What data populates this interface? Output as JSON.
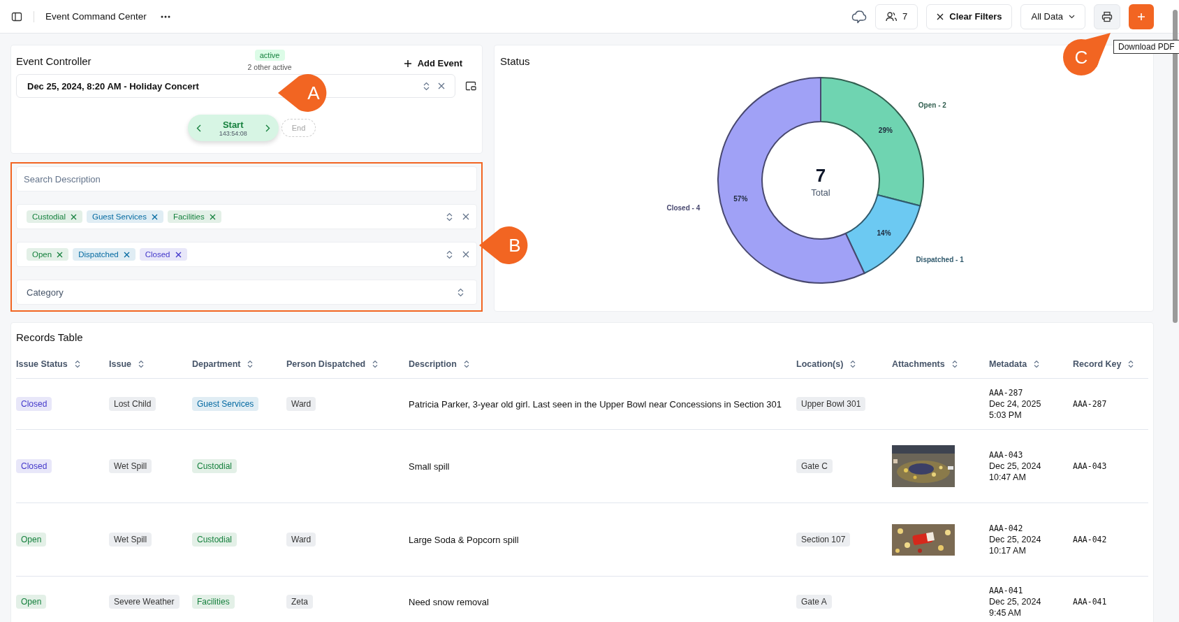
{
  "header": {
    "title": "Event Command Center",
    "users_count": "7",
    "clear_filters": "Clear Filters",
    "data_scope": "All Data",
    "tooltip": "Download PDF"
  },
  "event_controller": {
    "title": "Event Controller",
    "status_badge": "active",
    "other_active": "2 other active",
    "add_event": "Add Event",
    "event_value": "Dec 25, 2024, 8:20 AM - Holiday Concert",
    "start_label": "Start",
    "start_timer": "143:54:08",
    "end_label": "End",
    "end_disabled": true
  },
  "filters": {
    "highlighted": true,
    "search": {
      "placeholder": "Search Description"
    },
    "departments": [
      {
        "label": "Custodial",
        "color": "#15803d"
      },
      {
        "label": "Guest Services",
        "color": "#0369a1"
      },
      {
        "label": "Facilities",
        "color": "#15803d"
      }
    ],
    "statuses": [
      {
        "label": "Open",
        "color": "#15803d"
      },
      {
        "label": "Dispatched",
        "color": "#0369a1"
      },
      {
        "label": "Closed",
        "color": "#4338ca"
      }
    ],
    "category": {
      "placeholder": "Category"
    }
  },
  "status": {
    "title": "Status",
    "total": "7",
    "total_label": "Total",
    "chart_data": {
      "type": "donut",
      "categories": [
        "Open - 2",
        "Dispatched - 1",
        "Closed - 4"
      ],
      "values": [
        29,
        14,
        57
      ],
      "colors": [
        "#6fd4b1",
        "#6cc9f2",
        "#a0a1f6"
      ],
      "value_labels": [
        "29%",
        "14%",
        "57%"
      ]
    }
  },
  "records": {
    "title": "Records Table",
    "columns": [
      "Issue Status",
      "Issue",
      "Department",
      "Person Dispatched",
      "Description",
      "Location(s)",
      "Attachments",
      "Metadata",
      "Record Key"
    ],
    "rows": [
      {
        "status": {
          "label": "Closed",
          "color": "#4338ca"
        },
        "issue": "Lost Child",
        "department": {
          "label": "Guest Services",
          "color": "#0369a1"
        },
        "person": "Ward",
        "description": "Patricia Parker, 3-year old girl. Last seen in the Upper Bowl near Concessions in Section 301",
        "location": "Upper Bowl 301",
        "meta_key": "AAA-287",
        "meta_date": "Dec 24, 2025",
        "meta_time": "5:03 PM",
        "record_key": "AAA-287"
      },
      {
        "status": {
          "label": "Closed",
          "color": "#4338ca"
        },
        "issue": "Wet Spill",
        "department": {
          "label": "Custodial",
          "color": "#15803d"
        },
        "description": "Small spill",
        "location": "Gate C",
        "meta_key": "AAA-043",
        "meta_date": "Dec 25, 2024",
        "meta_time": "10:47 AM",
        "record_key": "AAA-043"
      },
      {
        "status": {
          "label": "Open",
          "color": "#15803d"
        },
        "issue": "Wet Spill",
        "department": {
          "label": "Custodial",
          "color": "#15803d"
        },
        "person": "Ward",
        "description": "Large Soda & Popcorn spill",
        "location": "Section 107",
        "meta_key": "AAA-042",
        "meta_date": "Dec 25, 2024",
        "meta_time": "10:17 AM",
        "record_key": "AAA-042"
      },
      {
        "status": {
          "label": "Open",
          "color": "#15803d"
        },
        "issue": "Severe Weather",
        "department": {
          "label": "Facilities",
          "color": "#15803d"
        },
        "person": "Zeta",
        "description": "Need snow removal",
        "location": "Gate A",
        "meta_key": "AAA-041",
        "meta_date": "Dec 25, 2024",
        "meta_time": "9:45 AM",
        "record_key": "AAA-041"
      }
    ]
  },
  "callouts": [
    {
      "label": "A"
    },
    {
      "label": "B"
    },
    {
      "label": "C"
    }
  ]
}
